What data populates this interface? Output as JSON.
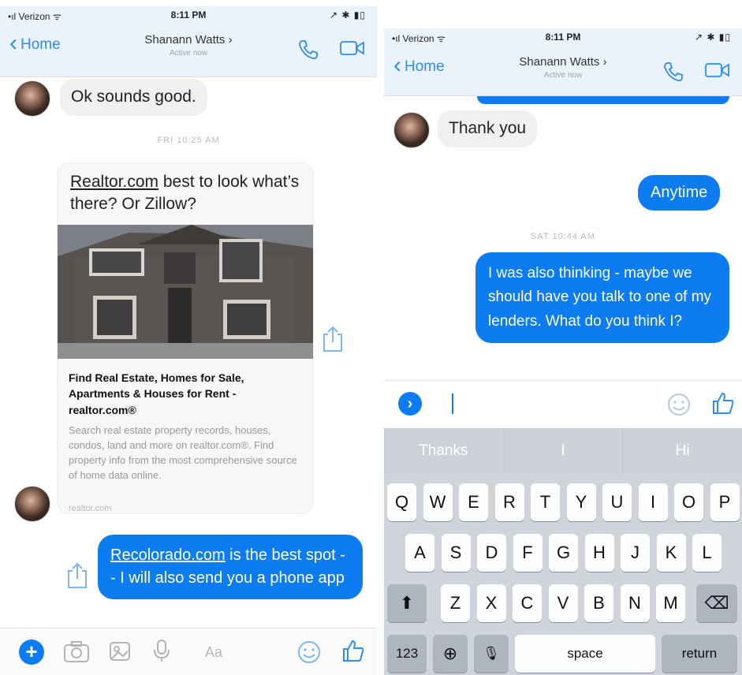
{
  "left": {
    "status": {
      "carrier": "Verizon",
      "time": "8:11 PM"
    },
    "nav": {
      "back_label": "Home",
      "contact_name": "Shanann Watts",
      "contact_sub": "Active now"
    },
    "messages": {
      "msg1": "Ok sounds good.",
      "timestamp1": "FRI 10:25 AM",
      "card_text_link": "Realtor.com",
      "card_text_rest": " best to look what’s there? Or Zillow?",
      "card_title": "Find Real Estate, Homes for Sale, Apartments & Houses for Rent - realtor.com®",
      "card_desc": "Search real estate property records, houses, condos, land and more on realtor.com®. Find property info from the most comprehensive source of home data online.",
      "card_domain": "realtor.com",
      "out_link": "Recolorado.com",
      "out_rest": " is the best spot -- I will also send you a phone app"
    },
    "input": {
      "placeholder": "Aa"
    }
  },
  "right": {
    "status": {
      "carrier": "Verizon",
      "time": "8:11 PM"
    },
    "nav": {
      "back_label": "Home",
      "contact_name": "Shanann Watts",
      "contact_sub": "Active now"
    },
    "messages": {
      "msg_in": "Thank you",
      "msg_out1": "Anytime",
      "timestamp": "SAT 10:44 AM",
      "msg_out2": "I was also thinking - maybe we should have you talk to one of my lenders. What do you think I?"
    },
    "keyboard": {
      "suggestions": [
        "Thanks",
        "I",
        "Hi"
      ],
      "row1": [
        "Q",
        "W",
        "E",
        "R",
        "T",
        "Y",
        "U",
        "I",
        "O",
        "P"
      ],
      "row2": [
        "A",
        "S",
        "D",
        "F",
        "G",
        "H",
        "J",
        "K",
        "L"
      ],
      "row3": [
        "Z",
        "X",
        "C",
        "V",
        "B",
        "N",
        "M"
      ],
      "numbers_label": "123",
      "space_label": "space",
      "return_label": "return"
    }
  },
  "colors": {
    "accent": "#0d7cf1",
    "nav_bg": "#eaf3fb",
    "bubble_in": "#f0f0f0"
  }
}
